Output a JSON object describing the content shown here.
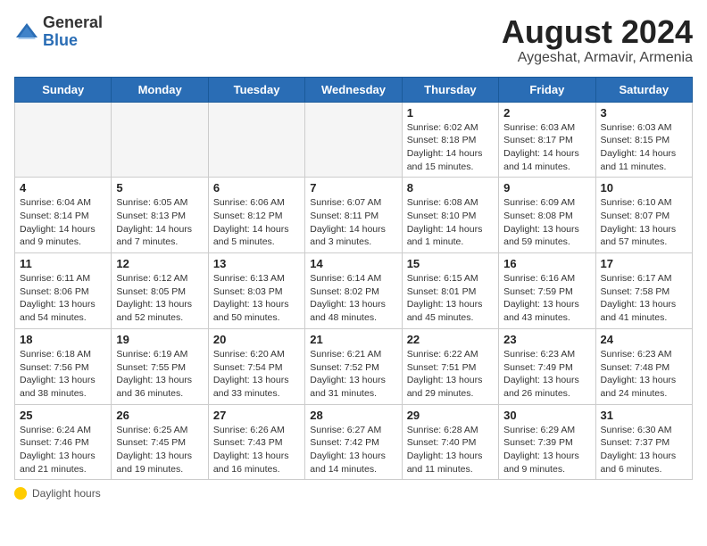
{
  "logo": {
    "general": "General",
    "blue": "Blue"
  },
  "title": "August 2024",
  "subtitle": "Aygeshat, Armavir, Armenia",
  "days_header": [
    "Sunday",
    "Monday",
    "Tuesday",
    "Wednesday",
    "Thursday",
    "Friday",
    "Saturday"
  ],
  "footer": "Daylight hours",
  "weeks": [
    [
      {
        "day": "",
        "info": ""
      },
      {
        "day": "",
        "info": ""
      },
      {
        "day": "",
        "info": ""
      },
      {
        "day": "",
        "info": ""
      },
      {
        "day": "1",
        "info": "Sunrise: 6:02 AM\nSunset: 8:18 PM\nDaylight: 14 hours and 15 minutes."
      },
      {
        "day": "2",
        "info": "Sunrise: 6:03 AM\nSunset: 8:17 PM\nDaylight: 14 hours and 14 minutes."
      },
      {
        "day": "3",
        "info": "Sunrise: 6:03 AM\nSunset: 8:15 PM\nDaylight: 14 hours and 11 minutes."
      }
    ],
    [
      {
        "day": "4",
        "info": "Sunrise: 6:04 AM\nSunset: 8:14 PM\nDaylight: 14 hours and 9 minutes."
      },
      {
        "day": "5",
        "info": "Sunrise: 6:05 AM\nSunset: 8:13 PM\nDaylight: 14 hours and 7 minutes."
      },
      {
        "day": "6",
        "info": "Sunrise: 6:06 AM\nSunset: 8:12 PM\nDaylight: 14 hours and 5 minutes."
      },
      {
        "day": "7",
        "info": "Sunrise: 6:07 AM\nSunset: 8:11 PM\nDaylight: 14 hours and 3 minutes."
      },
      {
        "day": "8",
        "info": "Sunrise: 6:08 AM\nSunset: 8:10 PM\nDaylight: 14 hours and 1 minute."
      },
      {
        "day": "9",
        "info": "Sunrise: 6:09 AM\nSunset: 8:08 PM\nDaylight: 13 hours and 59 minutes."
      },
      {
        "day": "10",
        "info": "Sunrise: 6:10 AM\nSunset: 8:07 PM\nDaylight: 13 hours and 57 minutes."
      }
    ],
    [
      {
        "day": "11",
        "info": "Sunrise: 6:11 AM\nSunset: 8:06 PM\nDaylight: 13 hours and 54 minutes."
      },
      {
        "day": "12",
        "info": "Sunrise: 6:12 AM\nSunset: 8:05 PM\nDaylight: 13 hours and 52 minutes."
      },
      {
        "day": "13",
        "info": "Sunrise: 6:13 AM\nSunset: 8:03 PM\nDaylight: 13 hours and 50 minutes."
      },
      {
        "day": "14",
        "info": "Sunrise: 6:14 AM\nSunset: 8:02 PM\nDaylight: 13 hours and 48 minutes."
      },
      {
        "day": "15",
        "info": "Sunrise: 6:15 AM\nSunset: 8:01 PM\nDaylight: 13 hours and 45 minutes."
      },
      {
        "day": "16",
        "info": "Sunrise: 6:16 AM\nSunset: 7:59 PM\nDaylight: 13 hours and 43 minutes."
      },
      {
        "day": "17",
        "info": "Sunrise: 6:17 AM\nSunset: 7:58 PM\nDaylight: 13 hours and 41 minutes."
      }
    ],
    [
      {
        "day": "18",
        "info": "Sunrise: 6:18 AM\nSunset: 7:56 PM\nDaylight: 13 hours and 38 minutes."
      },
      {
        "day": "19",
        "info": "Sunrise: 6:19 AM\nSunset: 7:55 PM\nDaylight: 13 hours and 36 minutes."
      },
      {
        "day": "20",
        "info": "Sunrise: 6:20 AM\nSunset: 7:54 PM\nDaylight: 13 hours and 33 minutes."
      },
      {
        "day": "21",
        "info": "Sunrise: 6:21 AM\nSunset: 7:52 PM\nDaylight: 13 hours and 31 minutes."
      },
      {
        "day": "22",
        "info": "Sunrise: 6:22 AM\nSunset: 7:51 PM\nDaylight: 13 hours and 29 minutes."
      },
      {
        "day": "23",
        "info": "Sunrise: 6:23 AM\nSunset: 7:49 PM\nDaylight: 13 hours and 26 minutes."
      },
      {
        "day": "24",
        "info": "Sunrise: 6:23 AM\nSunset: 7:48 PM\nDaylight: 13 hours and 24 minutes."
      }
    ],
    [
      {
        "day": "25",
        "info": "Sunrise: 6:24 AM\nSunset: 7:46 PM\nDaylight: 13 hours and 21 minutes."
      },
      {
        "day": "26",
        "info": "Sunrise: 6:25 AM\nSunset: 7:45 PM\nDaylight: 13 hours and 19 minutes."
      },
      {
        "day": "27",
        "info": "Sunrise: 6:26 AM\nSunset: 7:43 PM\nDaylight: 13 hours and 16 minutes."
      },
      {
        "day": "28",
        "info": "Sunrise: 6:27 AM\nSunset: 7:42 PM\nDaylight: 13 hours and 14 minutes."
      },
      {
        "day": "29",
        "info": "Sunrise: 6:28 AM\nSunset: 7:40 PM\nDaylight: 13 hours and 11 minutes."
      },
      {
        "day": "30",
        "info": "Sunrise: 6:29 AM\nSunset: 7:39 PM\nDaylight: 13 hours and 9 minutes."
      },
      {
        "day": "31",
        "info": "Sunrise: 6:30 AM\nSunset: 7:37 PM\nDaylight: 13 hours and 6 minutes."
      }
    ]
  ]
}
